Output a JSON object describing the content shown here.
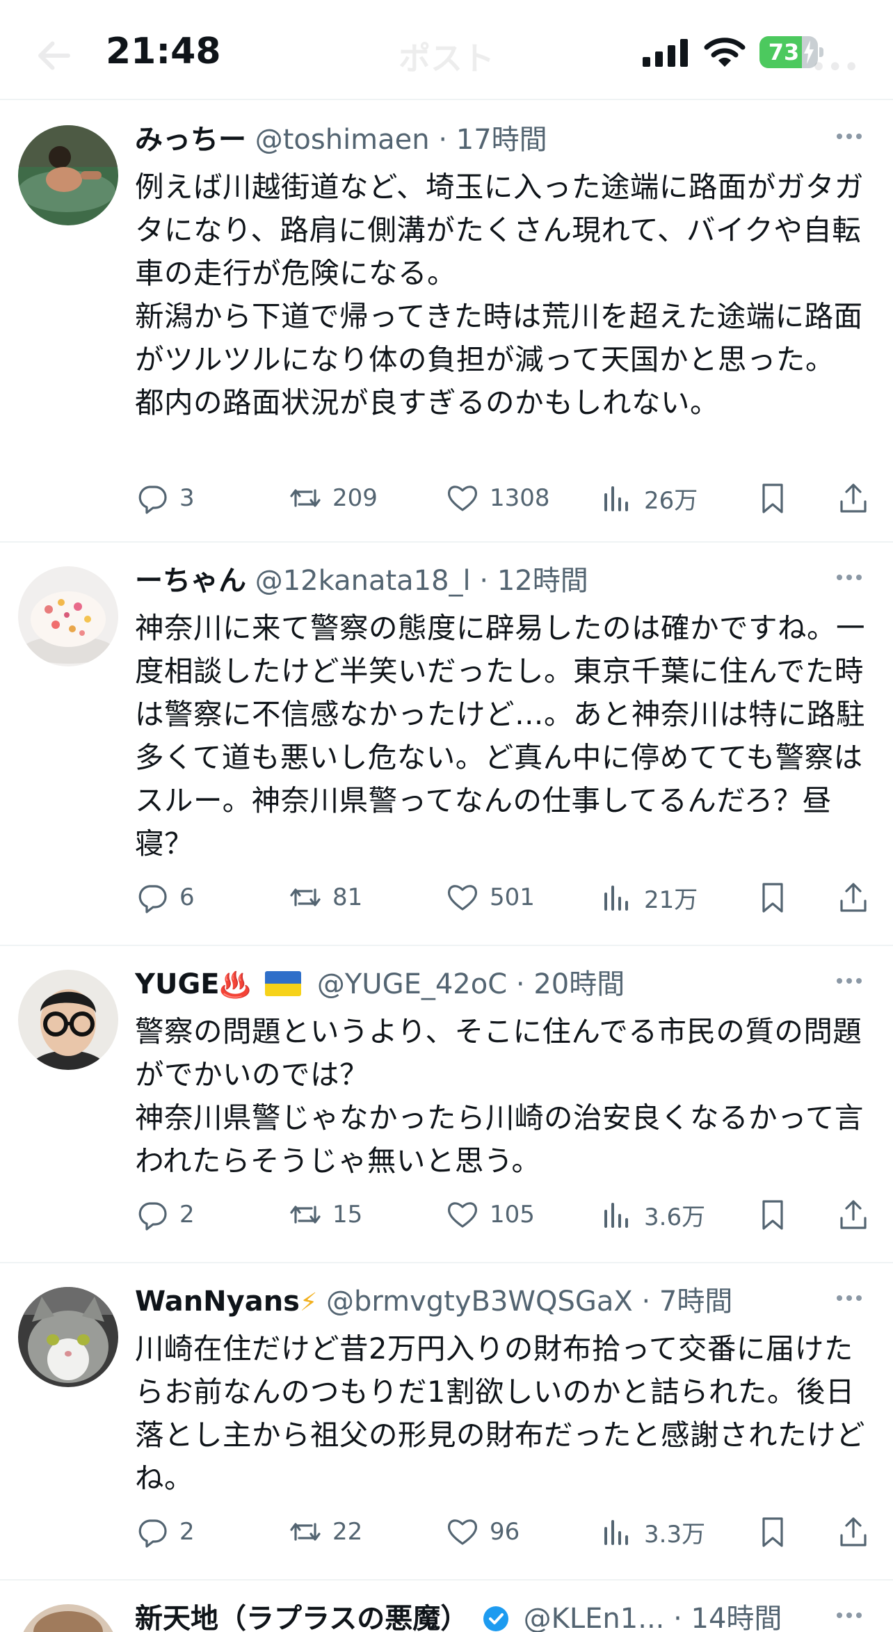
{
  "status_bar": {
    "time": "21:48",
    "battery": "73",
    "battery_level": 0.73
  },
  "header": {
    "title": "ポスト"
  },
  "replies": [
    {
      "name": "みっちー",
      "handle": "@toshimaen",
      "dot": "·",
      "age": "17時間",
      "text": "例えば川越街道など、埼玉に入った途端に路面がガタガタになり、路肩に側溝がたくさん現れて、バイクや自転車の走行が危険になる。\n新潟から下道で帰ってきた時は荒川を超えた途端に路面がツルツルになり体の負担が減って天国かと思った。\n都内の路面状況が良すぎるのかもしれない。",
      "replies": "3",
      "reposts": "209",
      "likes": "1308",
      "views": "26万"
    },
    {
      "name": "ーちゃん",
      "handle": "@12kanata18_l",
      "dot": "·",
      "age": "12時間",
      "text": "神奈川に来て警察の態度に辟易したのは確かですね。一度相談したけど半笑いだったし。東京千葉に住んでた時は警察に不信感なかったけど…。あと神奈川は特に路駐多くて道も悪いし危ない。ど真ん中に停めてても警察はスルー。神奈川県警ってなんの仕事してるんだろ？昼寝？",
      "replies": "6",
      "reposts": "81",
      "likes": "501",
      "views": "21万"
    },
    {
      "name": "YUGE",
      "name_emoji": "♨️",
      "handle": "@YUGE_42oC",
      "dot": "·",
      "age": "20時間",
      "text": "警察の問題というより、そこに住んでる市民の質の問題がでかいのでは？\n神奈川県警じゃなかったら川崎の治安良くなるかって言われたらそうじゃ無いと思う。",
      "replies": "2",
      "reposts": "15",
      "likes": "105",
      "views": "3.6万"
    },
    {
      "name": "WanNyans",
      "name_emoji": "⚡",
      "handle": "@brmvgtyB3WQSGaX",
      "dot": "·",
      "age": "7時間",
      "text": "川崎在住だけど昔2万円入りの財布拾って交番に届けたらお前なんのつもりだ1割欲しいのかと詰られた。後日落とし主から祖父の形見の財布だったと感謝されたけどね。",
      "replies": "2",
      "reposts": "22",
      "likes": "96",
      "views": "3.3万"
    },
    {
      "name": "新天地（ラプラスの悪魔）",
      "handle": "@KLEn1...",
      "dot": "·",
      "age": "14時間"
    }
  ]
}
